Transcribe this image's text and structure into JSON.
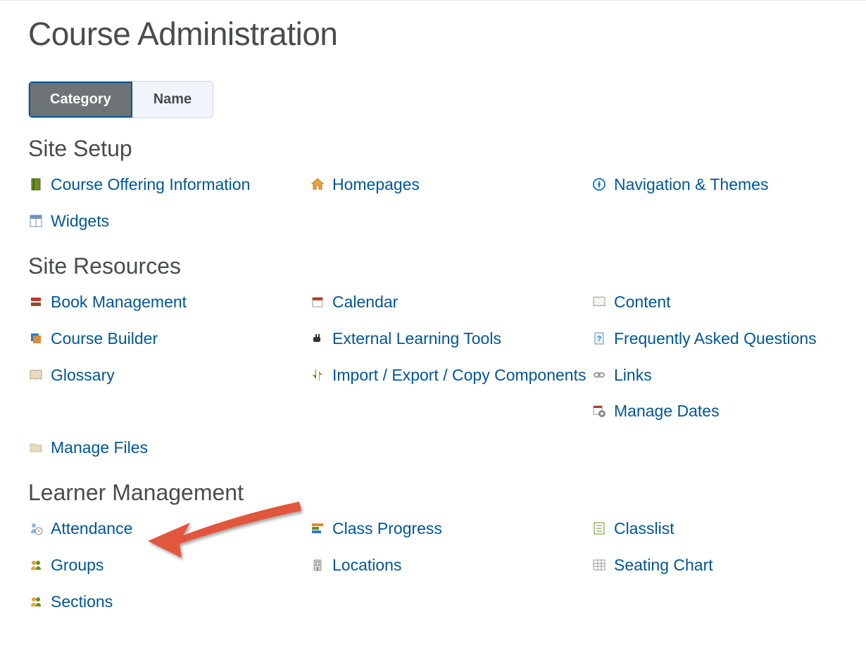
{
  "page": {
    "title": "Course Administration"
  },
  "tabs": {
    "category": "Category",
    "name": "Name",
    "active": "category"
  },
  "sections": [
    {
      "title": "Site Setup",
      "key": "site_setup",
      "tools": [
        {
          "label": "Course Offering Information",
          "icon": "book-green",
          "col": 1
        },
        {
          "label": "Homepages",
          "icon": "home-orange",
          "col": 2
        },
        {
          "label": "Navigation & Themes",
          "icon": "compass-blue",
          "col": 3
        },
        {
          "label": "Widgets",
          "icon": "grid-blue",
          "col": 1
        }
      ]
    },
    {
      "title": "Site Resources",
      "key": "site_resources",
      "tools": [
        {
          "label": "Book Management",
          "icon": "books-red",
          "col": 1
        },
        {
          "label": "Calendar",
          "icon": "calendar-red",
          "col": 2
        },
        {
          "label": "Content",
          "icon": "open-book",
          "col": 3
        },
        {
          "label": "Course Builder",
          "icon": "stack-blue",
          "col": 1
        },
        {
          "label": "External Learning Tools",
          "icon": "plug-dark",
          "col": 2
        },
        {
          "label": "Frequently Asked Questions",
          "icon": "page-question",
          "col": 3
        },
        {
          "label": "Glossary",
          "icon": "open-book-tan",
          "col": 1
        },
        {
          "label": "Import / Export / Copy Components",
          "icon": "arrows-green",
          "col": 2
        },
        {
          "label": "Links",
          "icon": "chain-gray",
          "col": 3
        },
        {
          "label": "",
          "icon": "",
          "col": 1,
          "empty": true
        },
        {
          "label": "",
          "icon": "",
          "col": 2,
          "empty": true
        },
        {
          "label": "Manage Dates",
          "icon": "calendar-gear",
          "col": 3
        },
        {
          "label": "Manage Files",
          "icon": "folder-tan",
          "col": 1
        }
      ]
    },
    {
      "title": "Learner Management",
      "key": "learner_management",
      "tools": [
        {
          "label": "Attendance",
          "icon": "person-clock",
          "col": 1
        },
        {
          "label": "Class Progress",
          "icon": "bars-colored",
          "col": 2
        },
        {
          "label": "Classlist",
          "icon": "list-green",
          "col": 3
        },
        {
          "label": "Groups",
          "icon": "people-yellow",
          "col": 1
        },
        {
          "label": "Locations",
          "icon": "building-gray",
          "col": 2
        },
        {
          "label": "Seating Chart",
          "icon": "seating-grid",
          "col": 3
        },
        {
          "label": "Sections",
          "icon": "people-yellow",
          "col": 1
        }
      ]
    }
  ],
  "annotation": {
    "arrow_points_to": "Attendance",
    "arrow_color": "#e2573c"
  }
}
